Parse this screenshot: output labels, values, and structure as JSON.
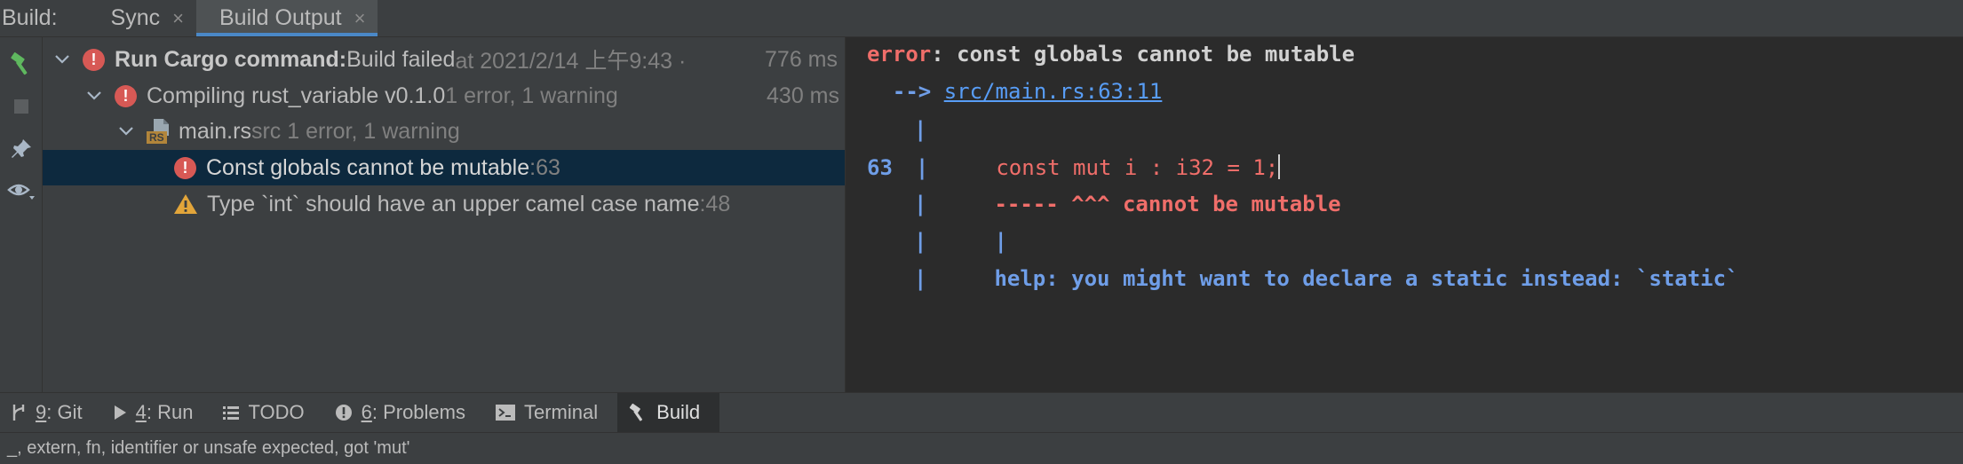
{
  "topbar": {
    "title": "Build:",
    "tabs": [
      {
        "label": "Sync",
        "close": "×"
      },
      {
        "label": "Build Output",
        "close": "×"
      }
    ]
  },
  "tree": {
    "rows": [
      {
        "bold": "Run Cargo command:",
        "text": " Build failed",
        "dim": " at 2021/2/14 上午9:43 ·",
        "time": "776 ms"
      },
      {
        "text": "Compiling rust_variable v0.1.0",
        "dim": "  1 error, 1 warning",
        "time": "430 ms"
      },
      {
        "text": "main.rs",
        "dim": " src 1 error, 1 warning",
        "file_badge": "RS"
      },
      {
        "text": "Const globals cannot be mutable",
        "dim": " :63"
      },
      {
        "text": "Type `int` should have an upper camel case name",
        "dim": " :48"
      }
    ]
  },
  "console": {
    "error_label": "error",
    "error_msg": ": const globals cannot be mutable",
    "arrow": "  -->",
    "location": "src/main.rs:63:11",
    "pipe": "|",
    "line_no": "63",
    "code": "const mut i : i32 = 1;",
    "underline": "----- ^^^ ",
    "underline_msg": "cannot be mutable",
    "help": "help: you might want to declare a static instead: `static`"
  },
  "bottombar": {
    "tabs": [
      {
        "key": "9",
        "label": ": Git"
      },
      {
        "key": "4",
        "label": ": Run"
      },
      {
        "label": "TODO"
      },
      {
        "key": "6",
        "label": ": Problems"
      },
      {
        "label": "Terminal"
      },
      {
        "label": "Build"
      }
    ]
  },
  "status": {
    "text": "_, extern, fn, identifier or unsafe expected, got 'mut'"
  },
  "colors": {
    "error": "#d75955",
    "selection": "#0d293e",
    "accent": "#4a88c7",
    "console_red": "#f06e6a",
    "console_blue": "#6f9ee8"
  }
}
